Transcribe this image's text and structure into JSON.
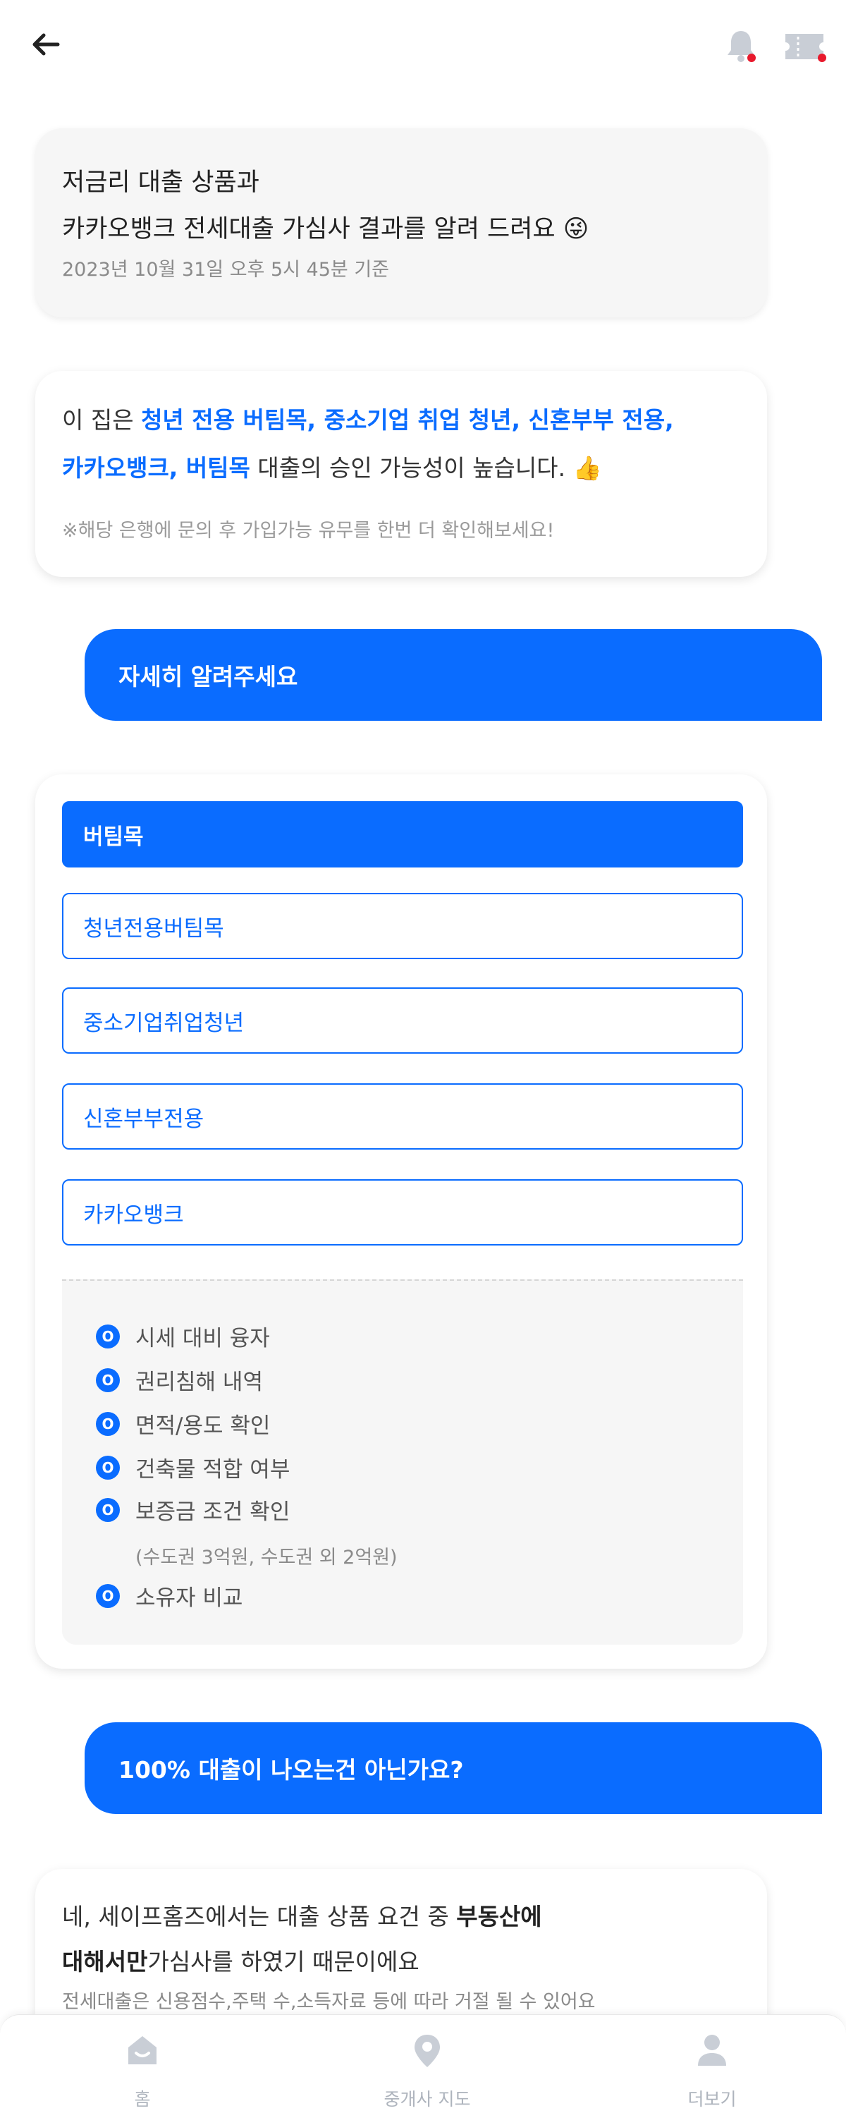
{
  "header": {
    "back_icon": "arrow-left-icon",
    "notification_icon": "bell-icon",
    "ticket_icon": "ticket-icon",
    "badge_color": "#e8192c"
  },
  "summary": {
    "title_line1": "저금리 대출 상품과",
    "title_line2": "카카오뱅크 전세대출 가심사 결과를 알려 드려요 😜",
    "date": "2023년 10월 31일 오후 5시 45분 기준"
  },
  "approval": {
    "prefix": "이 집은 ",
    "highlight1": "청년 전용 버팀목, 중소기업 취업 청년, 신혼부부 전용,",
    "highlight2": "카카오뱅크, 버팀목",
    "suffix": " 대출의 승인 가능성이 높습니다. 👍",
    "note": "※해당 은행에 문의 후 가입가능 유무를 한번 더 확인해보세요!"
  },
  "chat": {
    "detail_question": "자세히 알려주세요",
    "full_loan_question": "100% 대출이 나오는건 아닌가요?"
  },
  "products": {
    "items": [
      {
        "label": "버팀목",
        "active": true
      },
      {
        "label": "청년전용버팀목",
        "active": false
      },
      {
        "label": "중소기업취업청년",
        "active": false
      },
      {
        "label": "신혼부부전용",
        "active": false
      },
      {
        "label": "카카오뱅크",
        "active": false
      }
    ],
    "checks": [
      "시세 대비 융자",
      "권리침해 내역",
      "면적/용도 확인",
      "건축물 적합 여부",
      "보증금 조건 확인",
      "소유자 비교"
    ],
    "check_mark": "O",
    "deposit_condition_note": "(수도권 3억원, 수도권 외 2억원)"
  },
  "answer": {
    "part1": "네, 세이프홈즈에서는 대출 상품 요건 중 ",
    "bold1": "부동산에",
    "bold2": "대해서만",
    "part2": "가심사를 하였기 때문이에요",
    "note": "전세대출은 신용점수,주택 수,소득자료 등에 따라 거절 될 수 있어요"
  },
  "bottom_nav": {
    "home": "홈",
    "map": "중개사 지도",
    "more": "더보기"
  },
  "colors": {
    "primary": "#0a6cff",
    "text": "#333333",
    "muted": "#8a8a8a"
  }
}
